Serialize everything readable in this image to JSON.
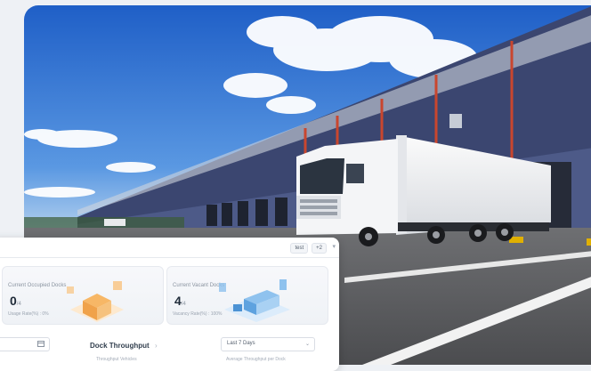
{
  "toolbar": {
    "chip_a": "test",
    "chip_b": "+2"
  },
  "cards": {
    "occupied": {
      "title": "Current Occupied Docks",
      "value": "0",
      "total": "/4",
      "sub": "Usage Rate(%) : 0%"
    },
    "vacant": {
      "title": "Current Vacant Docks",
      "value": "4",
      "total": "/4",
      "sub": "Vacancy Rate(%) : 100%"
    }
  },
  "throughput": {
    "title": "Dock Throughput",
    "range": "Last 7 Days",
    "sub_left": "Throughput Vehicles",
    "sub_right": "Average Throughput per Dock"
  },
  "colors": {
    "sky_top": "#2f6fd0",
    "warehouse": "#3e4c7a",
    "accent_pillar": "#c9462e"
  }
}
